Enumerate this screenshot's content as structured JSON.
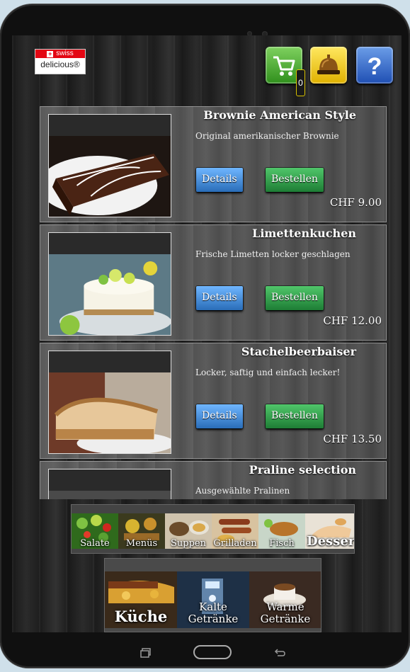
{
  "colors": {
    "details_button": "#2a6db8",
    "order_button": "#1e7d35",
    "cart_button": "#3c9a2a",
    "bell_button": "#f5cc10",
    "help_button": "#2f63c9",
    "logo_red": "#e30613"
  },
  "logo": {
    "top_text": "swiss",
    "bottom_text": "delicious®"
  },
  "toolbar": {
    "cart_icon": "shopping-cart-icon",
    "cart_count": "0",
    "bell_icon": "service-bell-icon",
    "help_icon": "question-mark-icon",
    "help_text": "?"
  },
  "products": [
    {
      "title": "Brownie American Style",
      "description": "Original amerikanischer Brownie",
      "details_label": "Details",
      "order_label": "Bestellen",
      "price": "CHF 9.00"
    },
    {
      "title": "Limettenkuchen",
      "description": "Frische Limetten locker geschlagen",
      "details_label": "Details",
      "order_label": "Bestellen",
      "price": "CHF 12.00"
    },
    {
      "title": "Stachelbeerbaiser",
      "description": "Locker, saftig und einfach lecker!",
      "details_label": "Details",
      "order_label": "Bestellen",
      "price": "CHF 13.50"
    },
    {
      "title": "Praline selection",
      "description": "Ausgewählte Pralinen"
    }
  ],
  "categories": [
    "Salate",
    "Menüs",
    "Suppen",
    "Grilladen",
    "Fisch",
    "Dessert"
  ],
  "active_category": "Dessert",
  "sections": [
    {
      "line1": "Küche",
      "line2": ""
    },
    {
      "line1": "Kalte",
      "line2": "Getränke"
    },
    {
      "line1": "Warme",
      "line2": "Getränke"
    }
  ],
  "system_nav": [
    "recent-apps-icon",
    "home-icon",
    "back-icon"
  ]
}
